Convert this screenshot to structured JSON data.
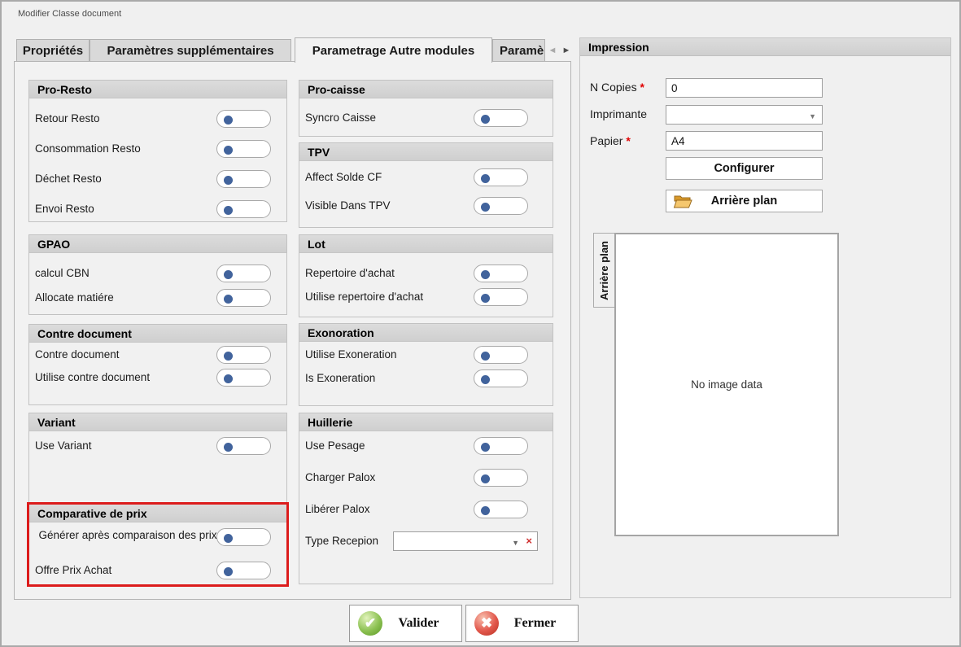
{
  "window": {
    "title": "Modifier Classe document"
  },
  "tabs": [
    {
      "label": "Propriétés",
      "active": false
    },
    {
      "label": "Paramètres supplémentaires",
      "active": false
    },
    {
      "label": "Parametrage Autre modules",
      "active": true
    },
    {
      "label": "Paramè",
      "active": false,
      "truncated": true
    }
  ],
  "tab_scroller": {
    "left": "◄",
    "right": "►"
  },
  "left_groups": [
    {
      "title": "Pro-Resto",
      "rows": [
        {
          "label": "Retour Resto",
          "state": "off"
        },
        {
          "label": "Consommation Resto",
          "state": "off"
        },
        {
          "label": "Déchet Resto",
          "state": "off"
        },
        {
          "label": "Envoi Resto",
          "state": "off"
        }
      ]
    },
    {
      "title": "GPAO",
      "rows": [
        {
          "label": "calcul CBN",
          "state": "off"
        },
        {
          "label": "Allocate matiére",
          "state": "off"
        }
      ]
    },
    {
      "title": "Contre document",
      "rows": [
        {
          "label": "Contre document",
          "state": "off"
        },
        {
          "label": "Utilise contre document",
          "state": "off"
        }
      ]
    },
    {
      "title": "Variant",
      "rows": [
        {
          "label": "Use Variant",
          "state": "off"
        }
      ]
    },
    {
      "title": "Comparative de prix",
      "highlighted": true,
      "rows": [
        {
          "label": "Générer après comparaison des prix",
          "state": "off"
        },
        {
          "label": "Offre Prix Achat",
          "state": "off"
        }
      ]
    }
  ],
  "middle_groups": [
    {
      "title": "Pro-caisse",
      "rows": [
        {
          "label": "Syncro Caisse",
          "state": "off"
        }
      ]
    },
    {
      "title": "TPV",
      "rows": [
        {
          "label": "Affect Solde CF",
          "state": "off"
        },
        {
          "label": "Visible Dans TPV",
          "state": "off"
        }
      ]
    },
    {
      "title": "Lot",
      "rows": [
        {
          "label": "Repertoire d'achat",
          "state": "off"
        },
        {
          "label": "Utilise repertoire d'achat",
          "state": "off"
        }
      ]
    },
    {
      "title": "Exonoration",
      "rows": [
        {
          "label": "Utilise Exoneration",
          "state": "off"
        },
        {
          "label": "Is Exoneration",
          "state": "off"
        }
      ]
    },
    {
      "title": "Huillerie",
      "rows": [
        {
          "label": "Use Pesage",
          "state": "off"
        },
        {
          "label": "Charger Palox",
          "state": "off"
        },
        {
          "label": "Libérer Palox",
          "state": "off"
        }
      ],
      "select_row": {
        "label": "Type Recepion",
        "value": "",
        "arrow_icon": "▼",
        "clear_icon": "×"
      }
    }
  ],
  "impression": {
    "title": "Impression",
    "n_copies": {
      "label": "N Copies",
      "required_mark": "*",
      "value": "0"
    },
    "imprimante": {
      "label": "Imprimante",
      "value": "",
      "arrow_icon": "▼"
    },
    "papier": {
      "label": "Papier",
      "required_mark": "*",
      "value": "A4"
    },
    "configurer_label": "Configurer",
    "arriere_plan_label": "Arrière plan",
    "preview_tab_label": "Arrière plan",
    "no_image_text": "No image data"
  },
  "footer": {
    "valider_label": "Valider",
    "valider_icon": "✔",
    "fermer_label": "Fermer",
    "fermer_icon": "✖"
  },
  "colors": {
    "highlight_red": "#dc1c1c",
    "toggle_dot": "#41639c",
    "required": "#e00000"
  }
}
